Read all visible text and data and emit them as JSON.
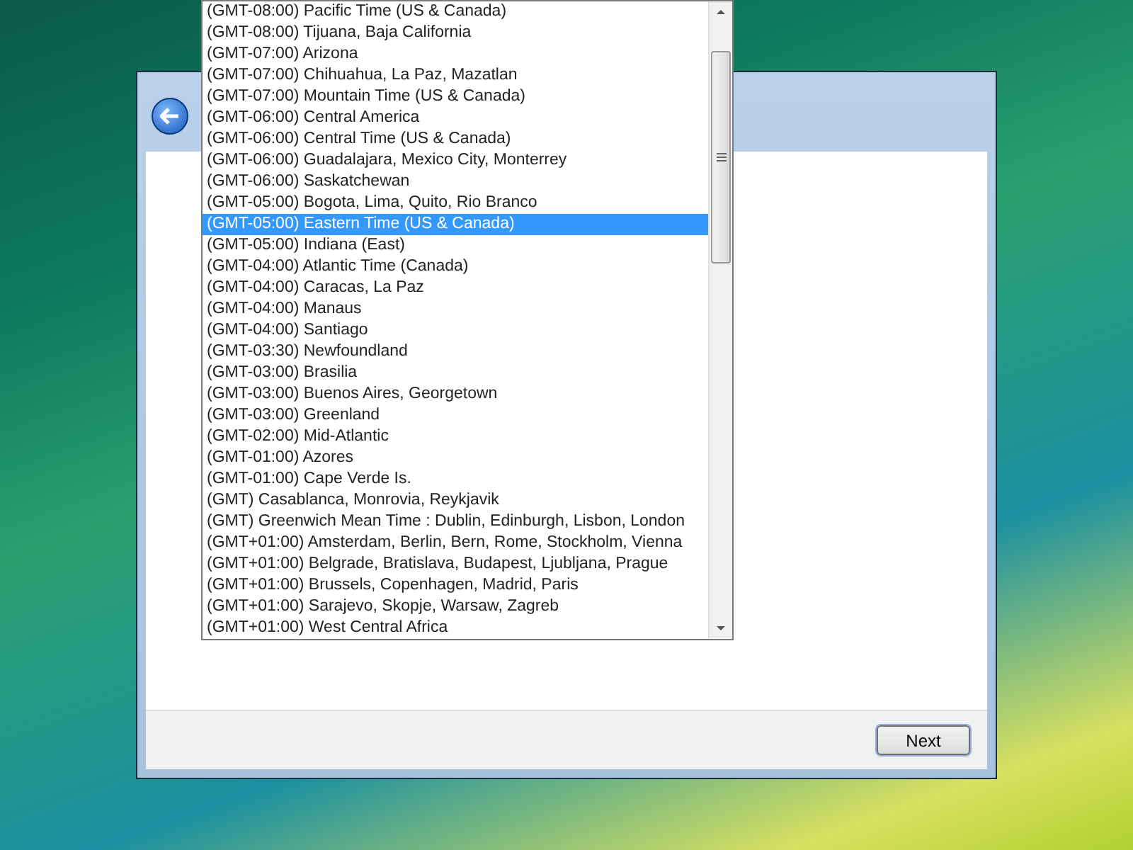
{
  "timezone_list": {
    "items": [
      {
        "label": "(GMT-08:00) Pacific Time (US & Canada)",
        "selected": false
      },
      {
        "label": "(GMT-08:00) Tijuana, Baja California",
        "selected": false
      },
      {
        "label": "(GMT-07:00) Arizona",
        "selected": false
      },
      {
        "label": "(GMT-07:00) Chihuahua, La Paz, Mazatlan",
        "selected": false
      },
      {
        "label": "(GMT-07:00) Mountain Time (US & Canada)",
        "selected": false
      },
      {
        "label": "(GMT-06:00) Central America",
        "selected": false
      },
      {
        "label": "(GMT-06:00) Central Time (US & Canada)",
        "selected": false
      },
      {
        "label": "(GMT-06:00) Guadalajara, Mexico City, Monterrey",
        "selected": false
      },
      {
        "label": "(GMT-06:00) Saskatchewan",
        "selected": false
      },
      {
        "label": "(GMT-05:00) Bogota, Lima, Quito, Rio Branco",
        "selected": false
      },
      {
        "label": "(GMT-05:00) Eastern Time (US & Canada)",
        "selected": true
      },
      {
        "label": "(GMT-05:00) Indiana (East)",
        "selected": false
      },
      {
        "label": "(GMT-04:00) Atlantic Time (Canada)",
        "selected": false
      },
      {
        "label": "(GMT-04:00) Caracas, La Paz",
        "selected": false
      },
      {
        "label": "(GMT-04:00) Manaus",
        "selected": false
      },
      {
        "label": "(GMT-04:00) Santiago",
        "selected": false
      },
      {
        "label": "(GMT-03:30) Newfoundland",
        "selected": false
      },
      {
        "label": "(GMT-03:00) Brasilia",
        "selected": false
      },
      {
        "label": "(GMT-03:00) Buenos Aires, Georgetown",
        "selected": false
      },
      {
        "label": "(GMT-03:00) Greenland",
        "selected": false
      },
      {
        "label": "(GMT-02:00) Mid-Atlantic",
        "selected": false
      },
      {
        "label": "(GMT-01:00) Azores",
        "selected": false
      },
      {
        "label": "(GMT-01:00) Cape Verde Is.",
        "selected": false
      },
      {
        "label": "(GMT) Casablanca, Monrovia, Reykjavik",
        "selected": false
      },
      {
        "label": "(GMT) Greenwich Mean Time : Dublin, Edinburgh, Lisbon, London",
        "selected": false
      },
      {
        "label": "(GMT+01:00) Amsterdam, Berlin, Bern, Rome, Stockholm, Vienna",
        "selected": false
      },
      {
        "label": "(GMT+01:00) Belgrade, Bratislava, Budapest, Ljubljana, Prague",
        "selected": false
      },
      {
        "label": "(GMT+01:00) Brussels, Copenhagen, Madrid, Paris",
        "selected": false
      },
      {
        "label": "(GMT+01:00) Sarajevo, Skopje, Warsaw, Zagreb",
        "selected": false
      },
      {
        "label": "(GMT+01:00) West Central Africa",
        "selected": false
      }
    ]
  },
  "footer": {
    "next_button": "Next"
  }
}
